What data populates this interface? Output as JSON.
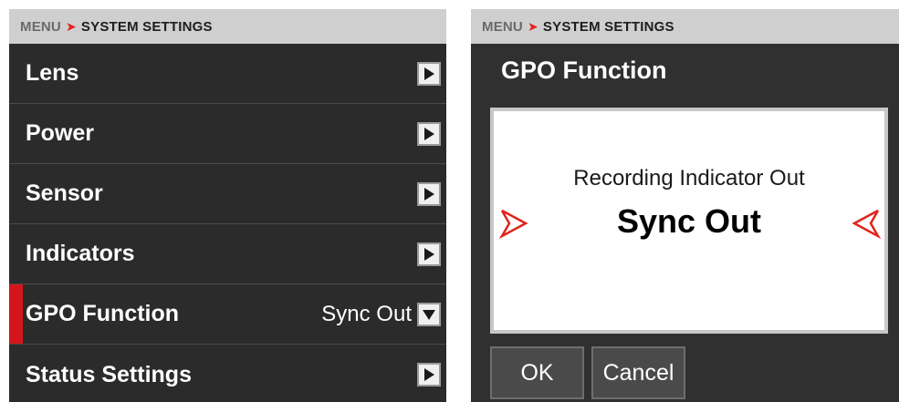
{
  "left": {
    "header": {
      "menu": "MENU",
      "separator": "➤",
      "title": "SYSTEM SETTINGS"
    },
    "items": [
      {
        "label": "Lens",
        "value": "",
        "control": "chevron-right-icon",
        "active": false
      },
      {
        "label": "Power",
        "value": "",
        "control": "chevron-right-icon",
        "active": false
      },
      {
        "label": "Sensor",
        "value": "",
        "control": "chevron-right-icon",
        "active": false
      },
      {
        "label": "Indicators",
        "value": "",
        "control": "chevron-right-icon",
        "active": false
      },
      {
        "label": "GPO Function",
        "value": "Sync Out",
        "control": "chevron-down-icon",
        "active": true
      },
      {
        "label": "Status Settings",
        "value": "",
        "control": "chevron-right-icon",
        "active": false
      }
    ]
  },
  "right": {
    "header": {
      "menu": "MENU",
      "separator": "➤",
      "title": "SYSTEM SETTINGS"
    },
    "dialog": {
      "title": "GPO Function",
      "previous_option": "Recording Indicator Out",
      "selected_option": "Sync Out",
      "ok_label": "OK",
      "cancel_label": "Cancel"
    }
  },
  "colors": {
    "accent": "#d4151b",
    "panel_bg": "#2b2b2b",
    "header_bg": "#cfcfcf"
  }
}
